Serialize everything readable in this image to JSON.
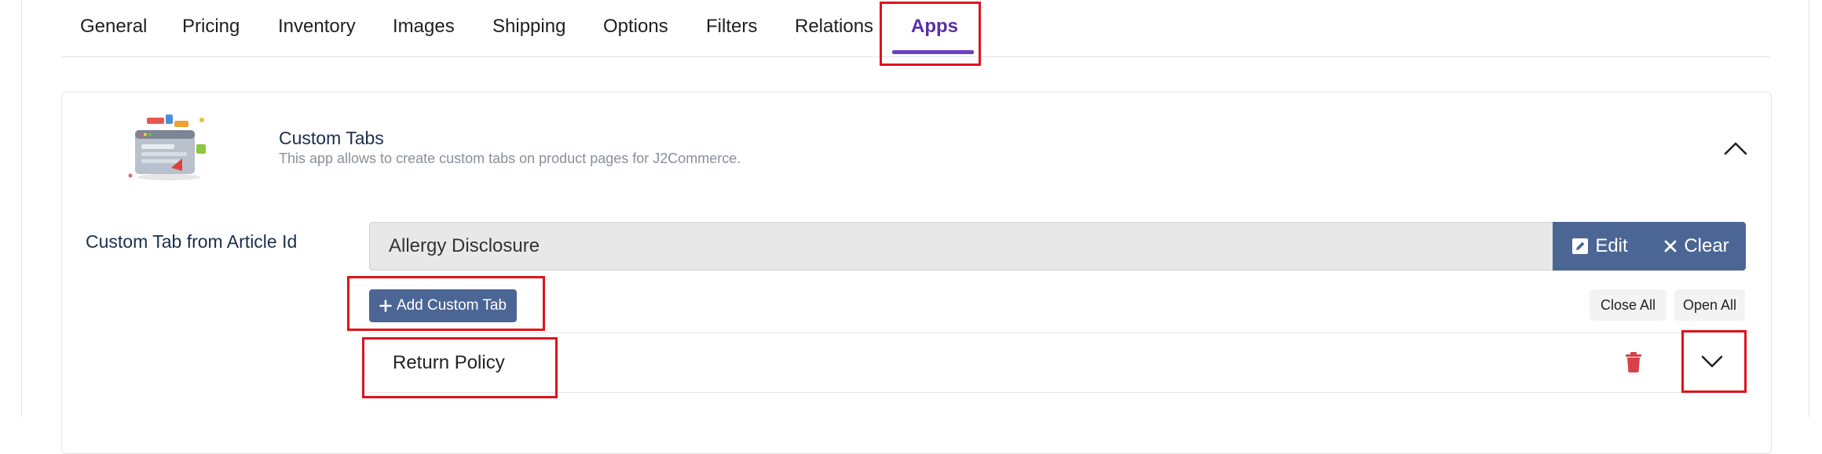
{
  "tabs": [
    {
      "label": "General"
    },
    {
      "label": "Pricing"
    },
    {
      "label": "Inventory"
    },
    {
      "label": "Images"
    },
    {
      "label": "Shipping"
    },
    {
      "label": "Options"
    },
    {
      "label": "Filters"
    },
    {
      "label": "Relations"
    },
    {
      "label": "Apps"
    }
  ],
  "active_tab": "Apps",
  "app": {
    "title": "Custom Tabs",
    "description": "This app allows to create custom tabs on product pages for J2Commerce."
  },
  "article_field": {
    "label": "Custom Tab from Article Id",
    "value": "Allergy Disclosure",
    "edit_label": "Edit",
    "clear_label": "Clear"
  },
  "actions": {
    "add_label": "Add Custom Tab",
    "close_all_label": "Close All",
    "open_all_label": "Open All"
  },
  "custom_tabs": [
    {
      "title": "Return Policy"
    }
  ],
  "colors": {
    "accent": "#6f3fc4",
    "primary_button": "#4b6694",
    "highlight": "#e0131c",
    "delete": "#d9414a"
  },
  "icons": [
    "chevron-up-icon",
    "edit-icon",
    "close-icon",
    "plus-icon",
    "trash-icon",
    "chevron-down-icon",
    "app-illustration"
  ]
}
